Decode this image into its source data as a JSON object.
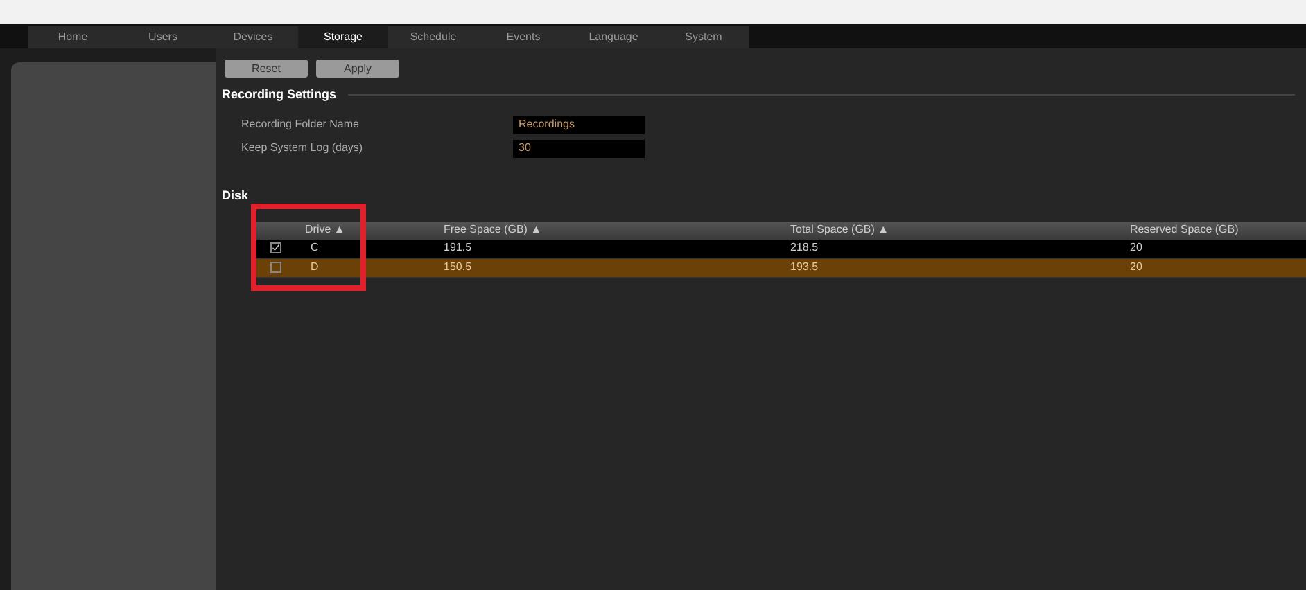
{
  "tabs": [
    {
      "label": "Home",
      "selected": false
    },
    {
      "label": "Users",
      "selected": false
    },
    {
      "label": "Devices",
      "selected": false
    },
    {
      "label": "Storage",
      "selected": true
    },
    {
      "label": "Schedule",
      "selected": false
    },
    {
      "label": "Events",
      "selected": false
    },
    {
      "label": "Language",
      "selected": false
    },
    {
      "label": "System",
      "selected": false
    }
  ],
  "buttons": [
    "Reset",
    "Apply"
  ],
  "recording_settings": {
    "title": "Recording Settings",
    "fields": [
      {
        "label": "Recording Folder Name",
        "value": "Recordings"
      },
      {
        "label": "Keep System Log (days)",
        "value": "30"
      }
    ]
  },
  "disk_section": {
    "title": "Disk",
    "columns": [
      "Drive ▲",
      "Free Space (GB) ▲",
      "Total Space (GB) ▲",
      "Reserved Space (GB)"
    ],
    "rows": [
      {
        "checked": true,
        "selected": false,
        "cells": [
          "C",
          "191.5",
          "218.5",
          "20"
        ]
      },
      {
        "checked": false,
        "selected": true,
        "cells": [
          "D",
          "150.5",
          "193.5",
          "20"
        ]
      }
    ]
  }
}
